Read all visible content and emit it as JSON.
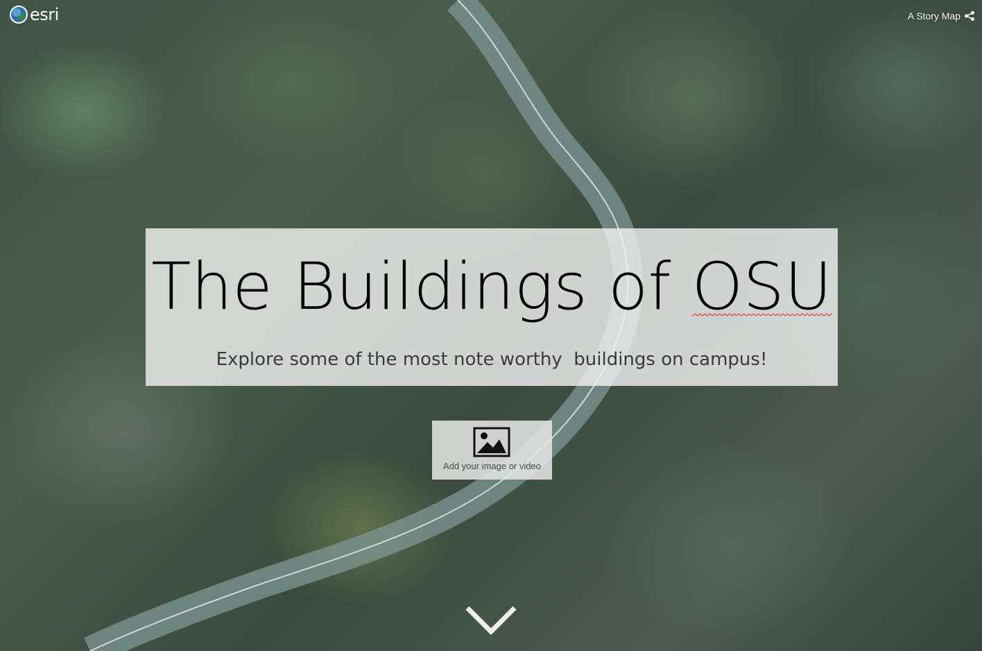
{
  "header": {
    "logo_text": "esri",
    "story_link": "A Story Map",
    "icons": {
      "logo": "esri-globe-icon",
      "share": "share-icon"
    }
  },
  "cover": {
    "title_prefix": "The Buildings of ",
    "title_highlight": "OSU",
    "subtitle": "Explore some of the most note worthy  buildings on campus!",
    "spellcheck_color": "#e0201a",
    "panel_color": "#f0f0f0"
  },
  "media": {
    "label": "Add your image or video",
    "icon": "image-icon"
  },
  "navigation": {
    "scroll_icon": "chevron-down-icon"
  }
}
